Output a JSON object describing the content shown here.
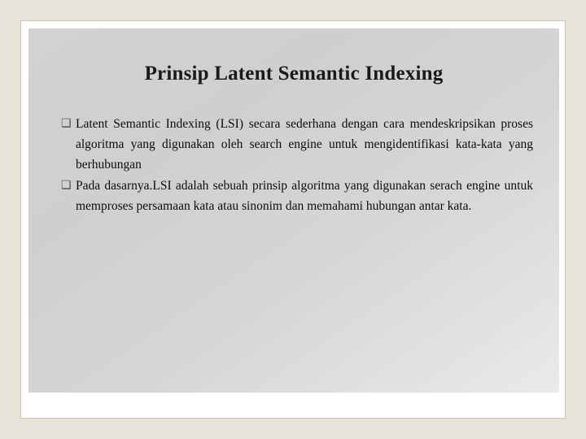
{
  "slide": {
    "title": "Prinsip Latent Semantic Indexing",
    "bullet_marker": "❏",
    "bullets": [
      {
        "marker": "❏",
        "text": "Latent Semantic Indexing (LSI) secara sederhana dengan cara mendeskripsikan proses algoritma yang digunakan oleh search engine untuk mengidentifikasi kata-kata yang berhubungan"
      },
      {
        "marker": "❏",
        "text": "Pada dasarnya.LSI adalah sebuah prinsip algoritma yang digunakan serach engine untuk memproses persamaan kata atau sinonim dan memahami hubungan antar kata."
      }
    ]
  },
  "colors": {
    "page_background": "#e8e4d9",
    "slide_background": "#ffffff",
    "content_panel_top": "#d2d2d2",
    "content_panel_bottom": "#eaeaea",
    "title_text": "#1a1a1a",
    "body_text": "#0d0d0d"
  }
}
